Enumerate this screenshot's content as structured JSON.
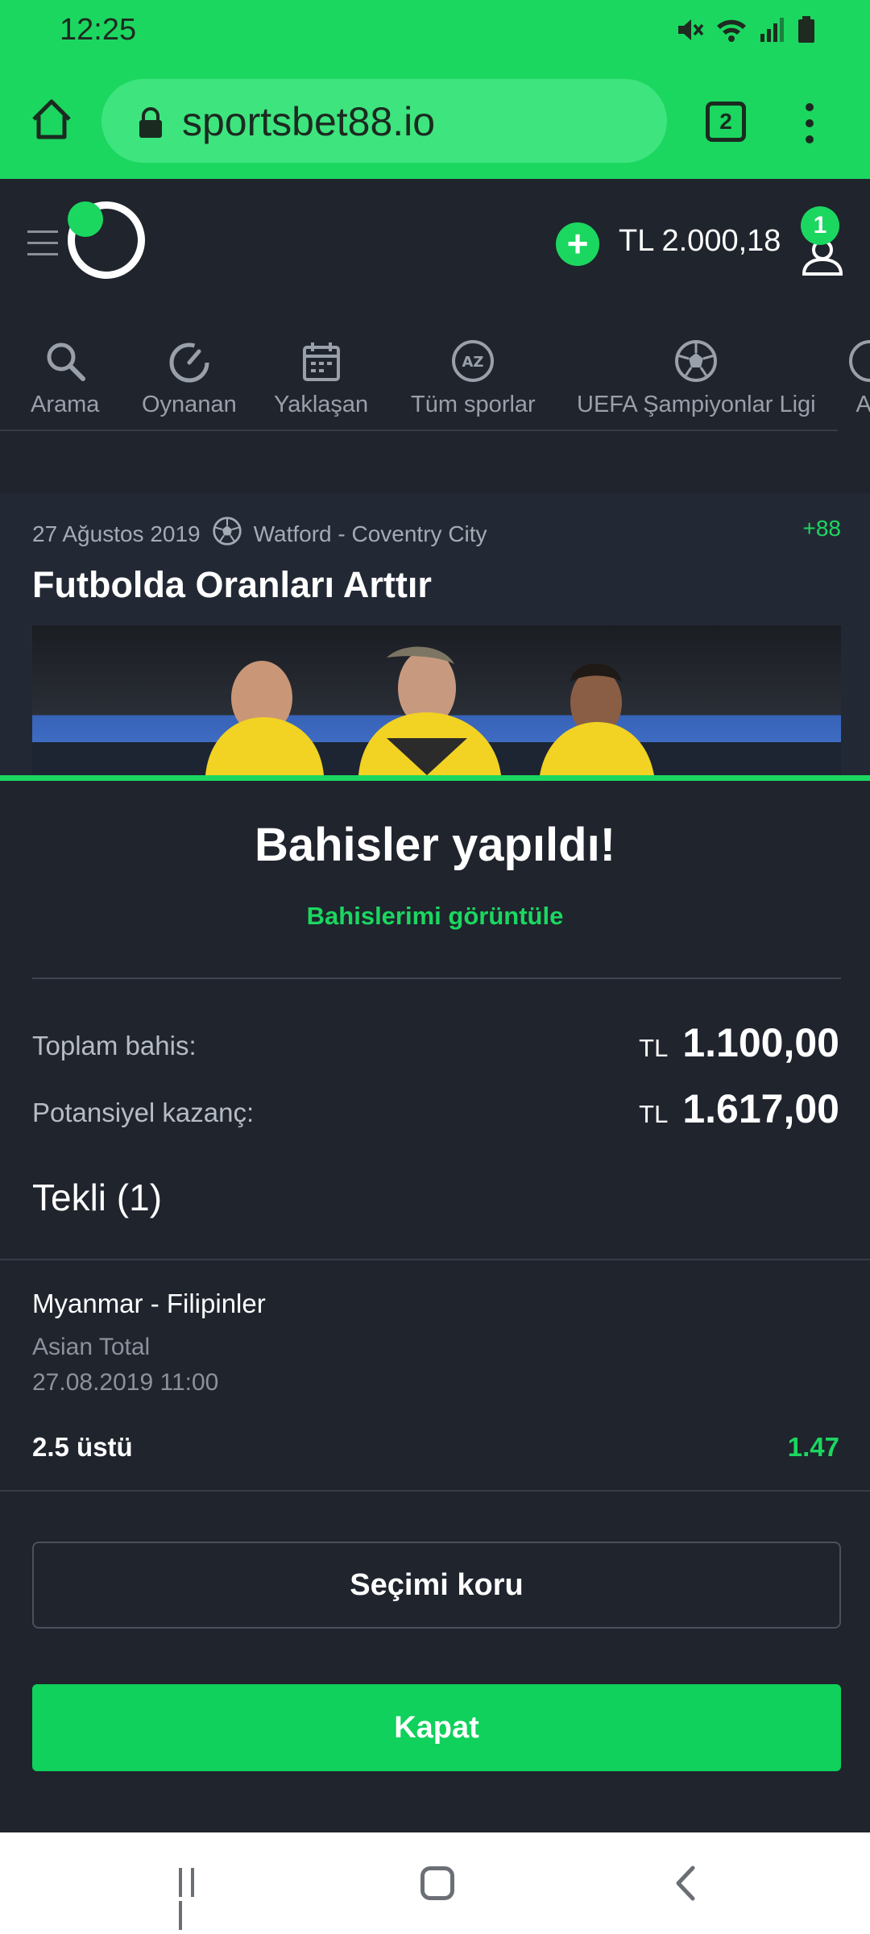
{
  "status_bar": {
    "time": "12:25",
    "icons": [
      "mute-icon",
      "wifi-icon",
      "signal-icon",
      "battery-icon"
    ]
  },
  "browser": {
    "url": "sportsbet88.io",
    "tab_count": "2"
  },
  "header": {
    "balance": "TL 2.000,18",
    "add_symbol": "+",
    "notification_count": "1"
  },
  "sports_nav": {
    "items": [
      {
        "label": "Arama",
        "icon": "search-icon"
      },
      {
        "label": "Oynanan",
        "icon": "speedometer-icon"
      },
      {
        "label": "Yaklaşan",
        "icon": "calendar-icon"
      },
      {
        "label": "Tüm sporlar",
        "icon": "az-icon"
      },
      {
        "label": "UEFA Şampiyonlar Ligi",
        "icon": "soccer-ball-icon"
      },
      {
        "label": "AT",
        "icon": "soccer-ball-icon"
      }
    ]
  },
  "promo": {
    "date": "27 Ağustos 2019",
    "match": "Watford - Coventry City",
    "count": "+88",
    "title": "Futbolda Oranları Arttır"
  },
  "sheet": {
    "title": "Bahisler yapıldı!",
    "view_link": "Bahislerimi görüntüle",
    "total_stake_label": "Toplam bahis:",
    "total_stake_currency": "TL",
    "total_stake_value": "1.100,00",
    "potential_win_label": "Potansiyel kazanç:",
    "potential_win_currency": "TL",
    "potential_win_value": "1.617,00",
    "single_title": "Tekli (1)",
    "bet": {
      "match": "Myanmar - Filipinler",
      "market": "Asian Total",
      "date": "27.08.2019 11:00",
      "selection": "2.5 üstü",
      "odds": "1.47"
    },
    "keep_button": "Seçimi koru",
    "close_button": "Kapat"
  },
  "colors": {
    "accent": "#1bd760",
    "background": "#1f242d"
  }
}
